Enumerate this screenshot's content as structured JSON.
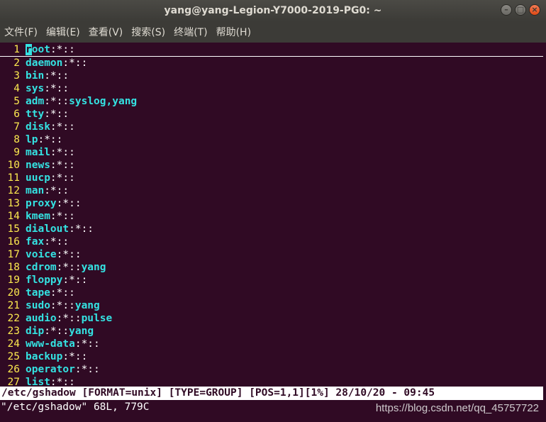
{
  "window": {
    "title": "yang@yang-Legion-Y7000-2019-PG0: ~",
    "buttons": {
      "minimize": "–",
      "maximize": "□",
      "close": "×"
    }
  },
  "menu": [
    "文件(F)",
    "编辑(E)",
    "查看(V)",
    "搜索(S)",
    "终端(T)",
    "帮助(H)"
  ],
  "file_lines": [
    {
      "n": "1",
      "name": "root",
      "rest": ":*::",
      "cursor": true
    },
    {
      "n": "2",
      "name": "daemon",
      "rest": ":*::"
    },
    {
      "n": "3",
      "name": "bin",
      "rest": ":*::"
    },
    {
      "n": "4",
      "name": "sys",
      "rest": ":*::"
    },
    {
      "n": "5",
      "name": "adm",
      "rest": ":*::",
      "members": "syslog,yang"
    },
    {
      "n": "6",
      "name": "tty",
      "rest": ":*::"
    },
    {
      "n": "7",
      "name": "disk",
      "rest": ":*::"
    },
    {
      "n": "8",
      "name": "lp",
      "rest": ":*::"
    },
    {
      "n": "9",
      "name": "mail",
      "rest": ":*::"
    },
    {
      "n": "10",
      "name": "news",
      "rest": ":*::"
    },
    {
      "n": "11",
      "name": "uucp",
      "rest": ":*::"
    },
    {
      "n": "12",
      "name": "man",
      "rest": ":*::"
    },
    {
      "n": "13",
      "name": "proxy",
      "rest": ":*::"
    },
    {
      "n": "14",
      "name": "kmem",
      "rest": ":*::"
    },
    {
      "n": "15",
      "name": "dialout",
      "rest": ":*::"
    },
    {
      "n": "16",
      "name": "fax",
      "rest": ":*::"
    },
    {
      "n": "17",
      "name": "voice",
      "rest": ":*::"
    },
    {
      "n": "18",
      "name": "cdrom",
      "rest": ":*::",
      "members": "yang"
    },
    {
      "n": "19",
      "name": "floppy",
      "rest": ":*::"
    },
    {
      "n": "20",
      "name": "tape",
      "rest": ":*::"
    },
    {
      "n": "21",
      "name": "sudo",
      "rest": ":*::",
      "members": "yang"
    },
    {
      "n": "22",
      "name": "audio",
      "rest": ":*::",
      "members": "pulse"
    },
    {
      "n": "23",
      "name": "dip",
      "rest": ":*::",
      "members": "yang"
    },
    {
      "n": "24",
      "name": "www-data",
      "rest": ":*::"
    },
    {
      "n": "25",
      "name": "backup",
      "rest": ":*::"
    },
    {
      "n": "26",
      "name": "operator",
      "rest": ":*::"
    },
    {
      "n": "27",
      "name": "list",
      "rest": ":*::"
    }
  ],
  "statusline": "/etc/gshadow [FORMAT=unix] [TYPE=GROUP] [POS=1,1][1%] 28/10/20 - 09:45",
  "cmdline": "\"/etc/gshadow\" 68L, 779C",
  "watermark": "https://blog.csdn.net/qq_45757722",
  "colors": {
    "background": "#300a24",
    "line_number": "#fce94f",
    "keyword": "#34e2e2",
    "text": "#ffffff"
  }
}
